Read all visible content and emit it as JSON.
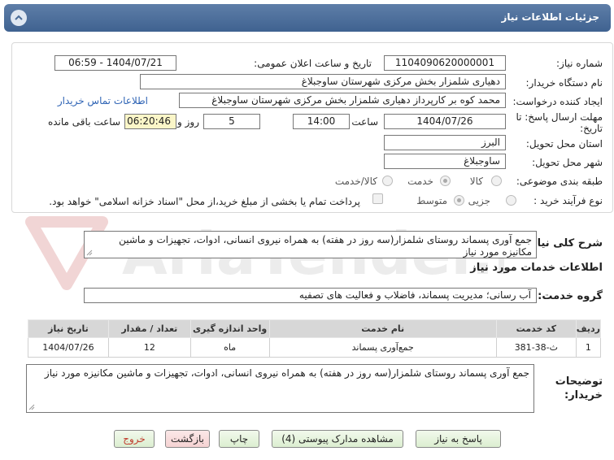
{
  "header": {
    "title": "جزئیات اطلاعات نیاز"
  },
  "fields": {
    "need_number_label": "شماره نیاز:",
    "need_number": "1104090620000001",
    "announce_label": "تاریخ و ساعت اعلان عمومی:",
    "announce_value": "1404/07/21 - 06:59",
    "buyer_org_label": "نام دستگاه خریدار:",
    "buyer_org": "دهیاری شلمزار بخش مرکزی شهرستان ساوجبلاغ",
    "creator_label": "ایجاد کننده درخواست:",
    "creator": "محمد کوه بر کارپرداز دهیاری شلمزار بخش مرکزی شهرستان ساوجبلاغ",
    "contact_link": "اطلاعات تماس خریدار",
    "deadline_label": "مهلت ارسال پاسخ: تا تاریخ:",
    "deadline_date": "1404/07/26",
    "time_label": "ساعت",
    "deadline_time": "14:00",
    "days_value": "5",
    "days_label": "روز و",
    "remaining_time": "06:20:46",
    "remaining_label": "ساعت باقی مانده",
    "province_label": "استان محل تحویل:",
    "province": "البرز",
    "city_label": "شهر محل تحویل:",
    "city": "ساوجبلاغ",
    "category_label": "طبقه بندی موضوعی:",
    "category_options": [
      "کالا",
      "خدمت",
      "کالا/خدمت"
    ],
    "process_label": "نوع فرآیند خرید :",
    "process_options": [
      "جزیی",
      "متوسط"
    ],
    "payment_note": "پرداخت تمام یا بخشی از مبلغ خرید،از محل \"اسناد خزانه اسلامی\" خواهد بود."
  },
  "summary": {
    "label": "شرح کلی نیاز:",
    "text": "جمع آوری پسماند روستای شلمزار(سه روز در هفته) به همراه نیروی انسانی، ادوات، تجهیزات و ماشین مکانیزه مورد نیاز"
  },
  "services": {
    "section_title": "اطلاعات خدمات مورد نیاز",
    "group_label": "گروه خدمت:",
    "group_value": "آب رسانی؛ مدیریت پسماند، فاضلاب و فعالیت های تصفیه",
    "columns": [
      "ردیف",
      "کد خدمت",
      "نام خدمت",
      "واحد اندازه گیری",
      "تعداد / مقدار",
      "تاریخ نیاز"
    ],
    "rows": [
      [
        "1",
        "ث-38-381",
        "جمع‌آوری پسماند",
        "ماه",
        "12",
        "1404/07/26"
      ]
    ]
  },
  "buyer_notes": {
    "label": "توضیحات خریدار:",
    "text": "جمع آوری پسماند روستای شلمزار(سه روز در هفته) به همراه نیروی انسانی، ادوات، تجهیزات و ماشین مکانیزه مورد نیاز"
  },
  "buttons": {
    "reply": "پاسخ به نیاز",
    "attachments": "مشاهده مدارک پیوستی (4)",
    "print": "چاپ",
    "back": "بازگشت",
    "exit": "خروج"
  },
  "watermark": {
    "text": "AriaTender.net"
  },
  "colors": {
    "header": "#4a6c98",
    "link": "#2f64b5",
    "remaining_bg": "#fbf6c8",
    "button_bg": "#e6f3dc"
  }
}
